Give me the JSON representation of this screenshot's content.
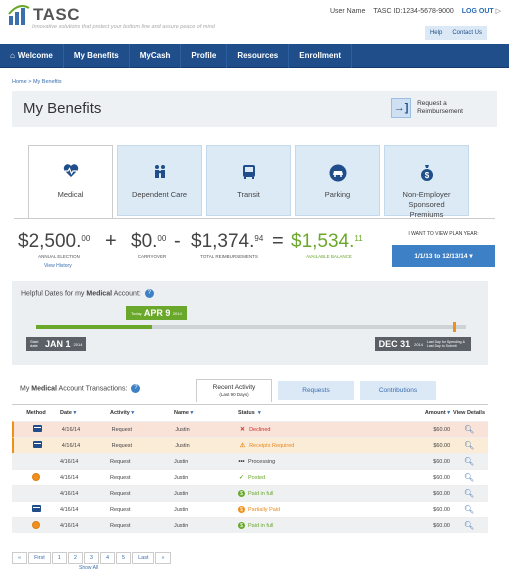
{
  "brand": {
    "name": "TASC",
    "tagline": "Innovative solutions that protect your bottom line and assure peace of mind"
  },
  "user": {
    "name_label": "User Name",
    "id_label": "TASC ID:1234-5678-9000",
    "logout": "LOG OUT"
  },
  "helpbar": {
    "help": "Help",
    "contact": "Contact Us"
  },
  "nav": [
    "Welcome",
    "My Benefits",
    "MyCash",
    "Profile",
    "Resources",
    "Enrollment"
  ],
  "breadcrumb": "Home > My Benefits",
  "page": {
    "title": "My Benefits",
    "reimburse_line1": "Request a",
    "reimburse_line2": "Reimbursement"
  },
  "tabs": [
    {
      "label": "Medical",
      "icon": "heart-pulse-icon"
    },
    {
      "label": "Dependent Care",
      "icon": "family-icon"
    },
    {
      "label": "Transit",
      "icon": "bus-icon"
    },
    {
      "label": "Parking",
      "icon": "car-icon"
    },
    {
      "label": "Non-Employer Sponsored Premiums",
      "icon": "money-bag-icon"
    }
  ],
  "summary": {
    "election": {
      "main": "$2,500.",
      "cents": "00",
      "label": "ANNUAL ELECTION"
    },
    "view_history": "View History",
    "carryover": {
      "main": "$0.",
      "cents": "00",
      "label": "CARRYOVER"
    },
    "reimb": {
      "main": "$1,374.",
      "cents": "94",
      "label": "TOTAL REIMBURSEMENTS"
    },
    "balance": {
      "main": "$1,534.",
      "cents": "11",
      "label": "AVAILABLE BALANCE"
    },
    "plan_year_head": "I WANT TO VIEW PLAN YEAR:",
    "plan_year_value": "1/1/13 to 12/13/14"
  },
  "dates": {
    "heading_pre": "Helpful Dates for my ",
    "heading_bold": "Medical",
    "heading_post": " Account:",
    "today_label": "Today",
    "today": "APR 9",
    "today_year": "2014",
    "start_label": "Start date",
    "start": "JAN 1",
    "start_year": "2014",
    "end": "DEC 31",
    "end_year": "2014",
    "end_note": "Last Day for Spending & Last Day to Submit",
    "progress": 0.27
  },
  "transactions": {
    "heading_pre": "My ",
    "heading_bold": "Medical",
    "heading_post": " Account Transactions:",
    "tabs": {
      "recent": "Recent Activity",
      "recent_sub": "(Last 90 Days)",
      "requests": "Requests",
      "contributions": "Contributions"
    },
    "columns": [
      "Method",
      "Date",
      "Activity",
      "Name",
      "Status",
      "Amount",
      "View Details"
    ],
    "rows": [
      {
        "method": "card",
        "date": "4/16/14",
        "activity": "Request",
        "name": "Justin",
        "status": "Declined",
        "status_type": "declined",
        "amount": "$60.00"
      },
      {
        "method": "card",
        "date": "4/16/14",
        "activity": "Request",
        "name": "Justin",
        "status": "Receipts Required",
        "status_type": "receipts",
        "amount": "$60.00"
      },
      {
        "method": "",
        "date": "4/16/14",
        "activity": "Request",
        "name": "Justin",
        "status": "Processing",
        "status_type": "processing",
        "amount": "$60.00"
      },
      {
        "method": "circle",
        "date": "4/16/14",
        "activity": "Request",
        "name": "Justin",
        "status": "Posted",
        "status_type": "posted",
        "amount": "$60.00"
      },
      {
        "method": "",
        "date": "4/16/14",
        "activity": "Request",
        "name": "Justin",
        "status": "Paid in full",
        "status_type": "paid",
        "amount": "$60.00"
      },
      {
        "method": "card",
        "date": "4/16/14",
        "activity": "Request",
        "name": "Justin",
        "status": "Partially Paid",
        "status_type": "partial",
        "amount": "$60.00"
      },
      {
        "method": "circle",
        "date": "4/16/14",
        "activity": "Request",
        "name": "Justin",
        "status": "Paid in full",
        "status_type": "paid",
        "amount": "$60.00"
      }
    ]
  },
  "pager": {
    "items": [
      "«",
      "First",
      "1",
      "2",
      "3",
      "4",
      "5",
      "Last",
      "»"
    ],
    "show_all": "Show All"
  }
}
